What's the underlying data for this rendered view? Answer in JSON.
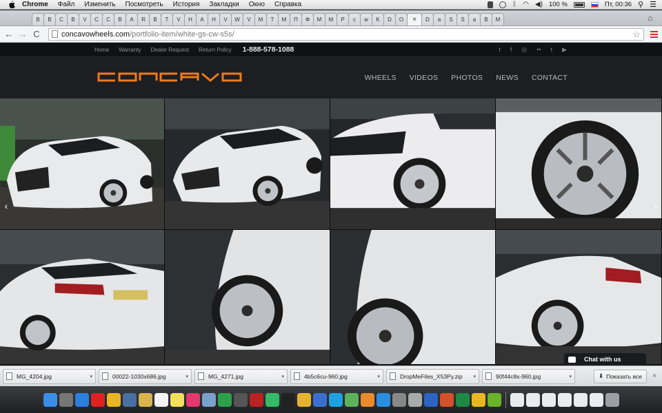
{
  "menubar": {
    "app": "Chrome",
    "items": [
      "Файл",
      "Изменить",
      "Посмотреть",
      "История",
      "Закладки",
      "Окно",
      "Справка"
    ],
    "battery": "100 %",
    "clock": "Пт, 00:36"
  },
  "tabs": {
    "labels": [
      "B",
      "B",
      "C",
      "B",
      "V",
      "C",
      "C",
      "B",
      "A",
      "R",
      "B",
      "T",
      "V",
      "H",
      "A",
      "H",
      "V",
      "W",
      "V",
      "M",
      "T",
      "M",
      "П",
      "Ф",
      "M",
      "M",
      "P",
      "c",
      "w",
      "K",
      "D",
      "O"
    ],
    "active_label": "×",
    "after_active": [
      "D",
      "a",
      "S",
      "S",
      "a",
      "B",
      "M"
    ]
  },
  "toolbar": {
    "back": "←",
    "forward": "→",
    "reload": "C",
    "url_domain": "concavowheels.com",
    "url_path": "/portfolio-item/white-gs-cw-s5s/"
  },
  "site": {
    "toplinks": [
      "Home",
      "Warranty",
      "Dealer Request",
      "Return Policy"
    ],
    "phone": "1-888-578-1088",
    "social_icons": [
      "twitter-icon",
      "facebook-icon",
      "instagram-icon",
      "flickr-icon",
      "tumblr-icon",
      "youtube-icon"
    ],
    "social_glyphs": [
      "t",
      "f",
      "◎",
      "••",
      "t",
      "▶"
    ],
    "logo_text": "CONCAVO",
    "nav": [
      "WHEELS",
      "VIDEOS",
      "PHOTOS",
      "NEWS",
      "CONTACT"
    ],
    "accent": "#f07a1a",
    "prev_arrow": "‹",
    "next_arrow": "›"
  },
  "chat": {
    "label": "Chat with us"
  },
  "downloads": {
    "items": [
      "MG_4204.jpg",
      "00022-1030x686.jpg",
      "MG_4271.jpg",
      "4b5c6cu-960.jpg",
      "DropMeFiles_X53Py.zip",
      "90f44c8s-960.jpg"
    ],
    "show_all": "Показать все",
    "close": "×"
  }
}
